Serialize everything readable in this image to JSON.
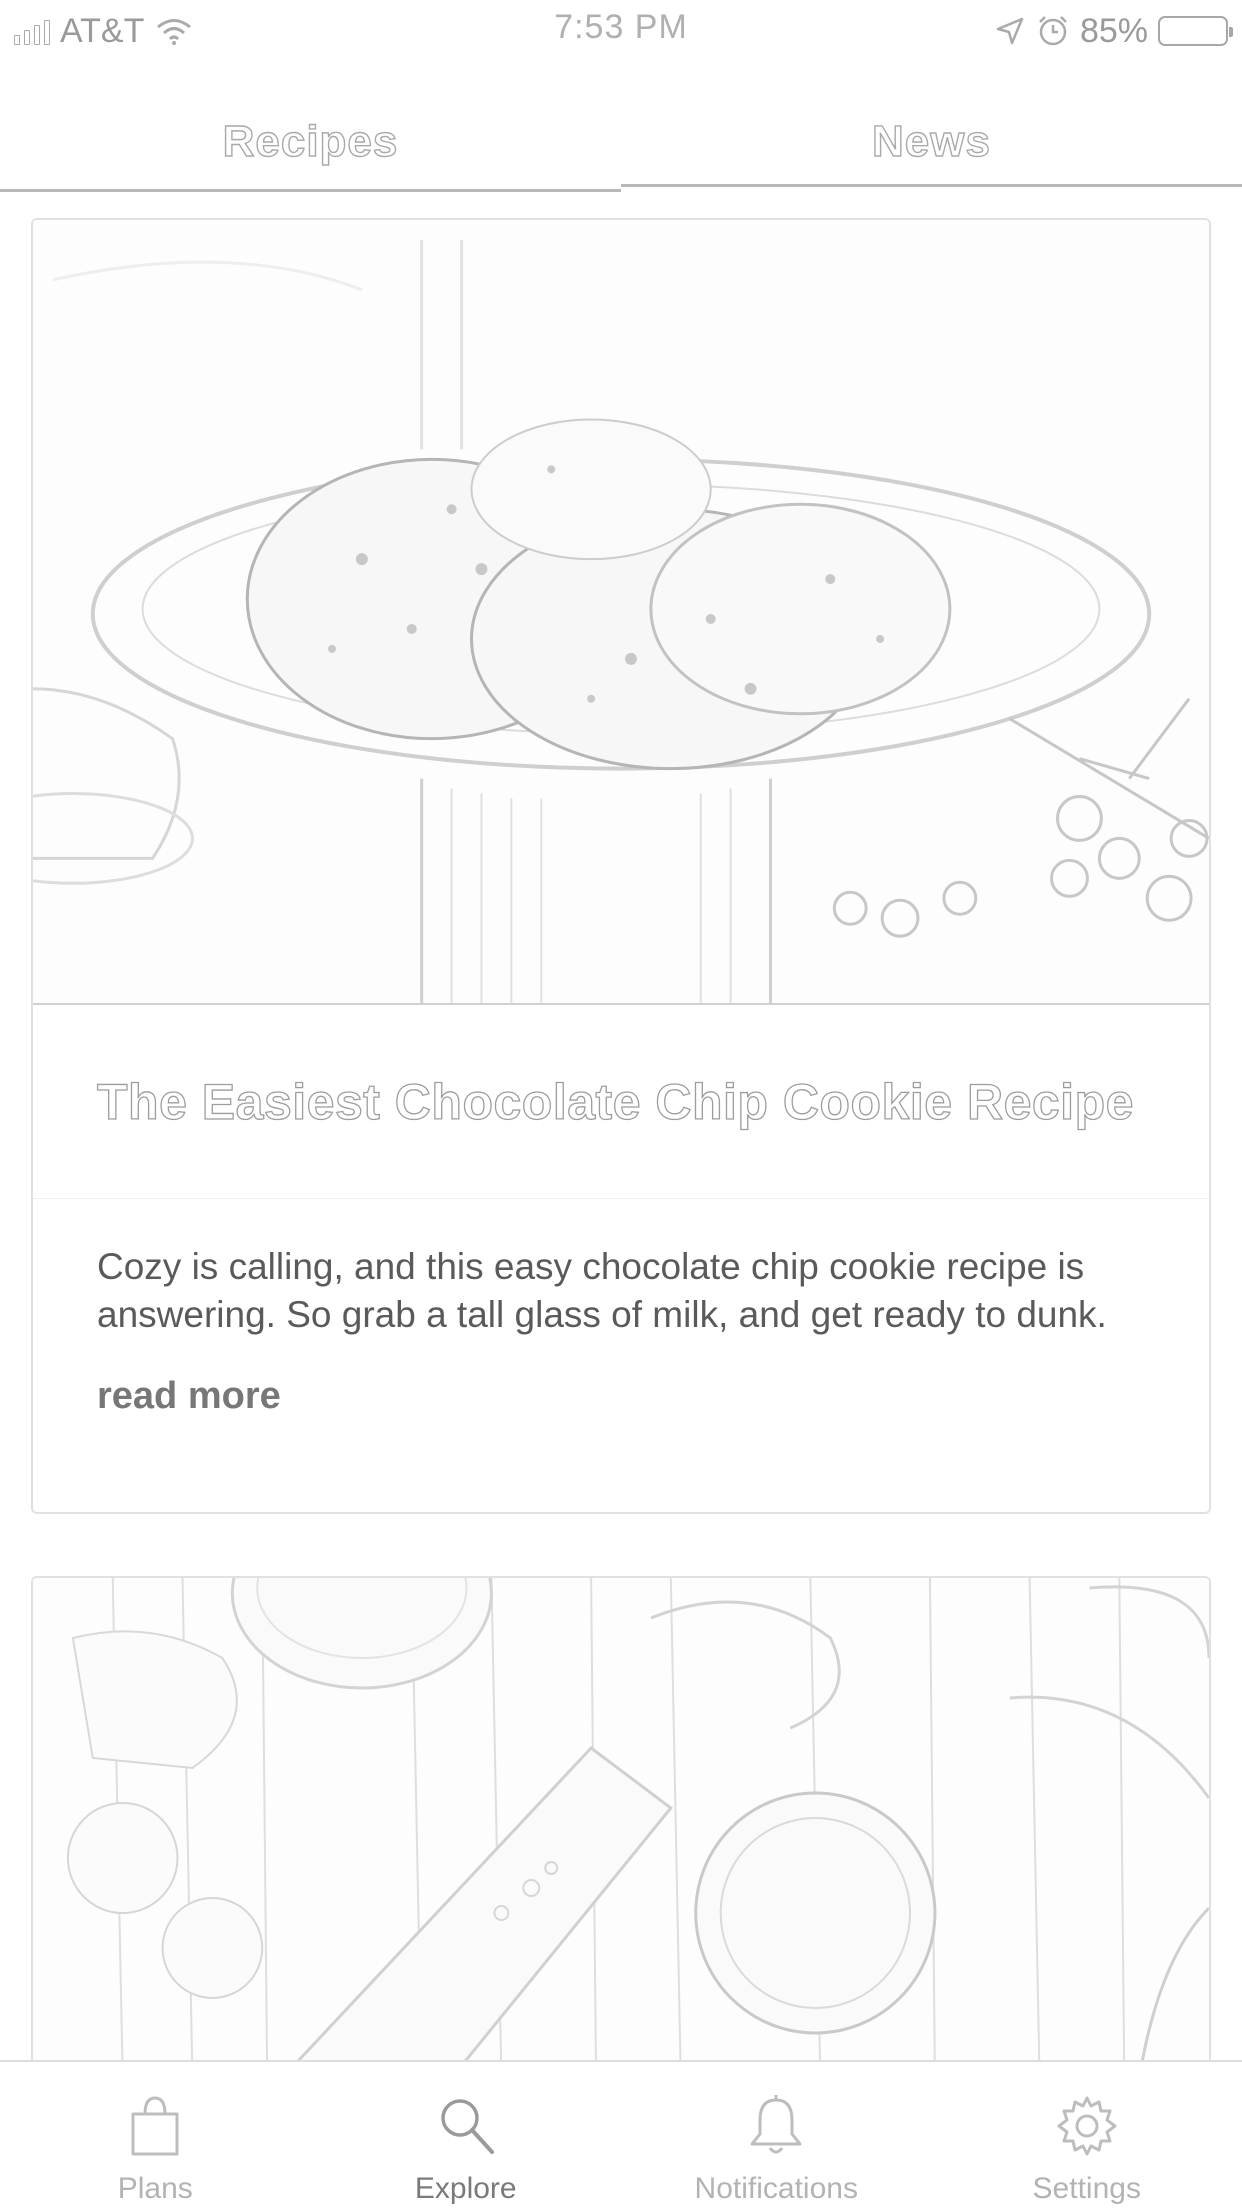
{
  "status_bar": {
    "carrier": "AT&T",
    "time": "7:53 PM",
    "battery": "85%",
    "icons": [
      "signal-icon",
      "wifi-icon",
      "location-icon",
      "alarm-icon",
      "battery-icon"
    ]
  },
  "tabs": [
    {
      "label": "Recipes",
      "active": false
    },
    {
      "label": "News",
      "active": true
    }
  ],
  "articles": [
    {
      "title": "The Easiest Chocolate Chip Cookie Recipe",
      "description": "Cozy is calling, and this easy chocolate chip cookie recipe is answering. So grab a tall glass of milk, and get ready to dunk.",
      "link_label": "read more"
    }
  ],
  "bottom_nav": [
    {
      "label": "Plans",
      "icon": "shopping-bag-icon",
      "active": false
    },
    {
      "label": "Explore",
      "icon": "search-icon",
      "active": true
    },
    {
      "label": "Notifications",
      "icon": "bell-icon",
      "active": false
    },
    {
      "label": "Settings",
      "icon": "gear-icon",
      "active": false
    }
  ],
  "colors": {
    "background": "#ffffff",
    "border": "#e1e1e1",
    "text": "#5a5a5a",
    "muted": "#b3b3b3"
  }
}
